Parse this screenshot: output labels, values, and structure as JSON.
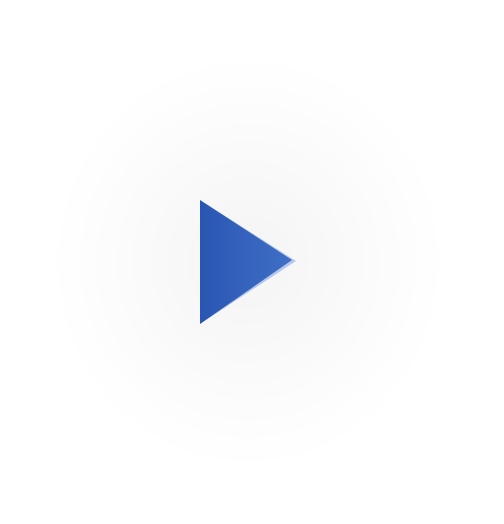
{
  "player": {
    "icon": "play-icon",
    "accent_color": "#2a59b8",
    "highlight_color": "#8fb0e8"
  }
}
